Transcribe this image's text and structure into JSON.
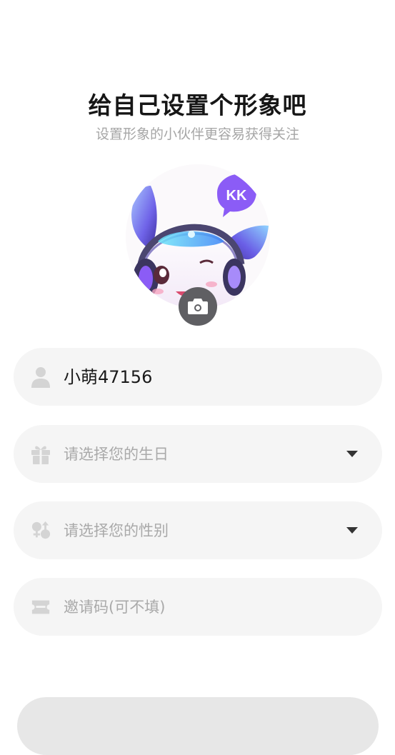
{
  "header": {
    "title": "给自己设置个形象吧",
    "subtitle": "设置形象的小伙伴更容易获得关注"
  },
  "avatar": {
    "badge_text": "KK",
    "camera_icon": "camera-icon"
  },
  "form": {
    "nickname": {
      "value": "小萌47156",
      "icon": "user-icon"
    },
    "birthday": {
      "placeholder": "请选择您的生日",
      "icon": "gift-icon"
    },
    "gender": {
      "placeholder": "请选择您的性别",
      "icon": "gender-icon"
    },
    "invite_code": {
      "placeholder": "邀请码(可不填)",
      "icon": "ticket-icon"
    }
  },
  "colors": {
    "field_bg": "#f5f5f5",
    "title": "#161616",
    "subtitle": "#a6a6a6",
    "placeholder": "#a9a9a9",
    "icon": "#d4d4d4",
    "camera_bg": "#5f5f63",
    "badge": "#8b5cf6"
  }
}
